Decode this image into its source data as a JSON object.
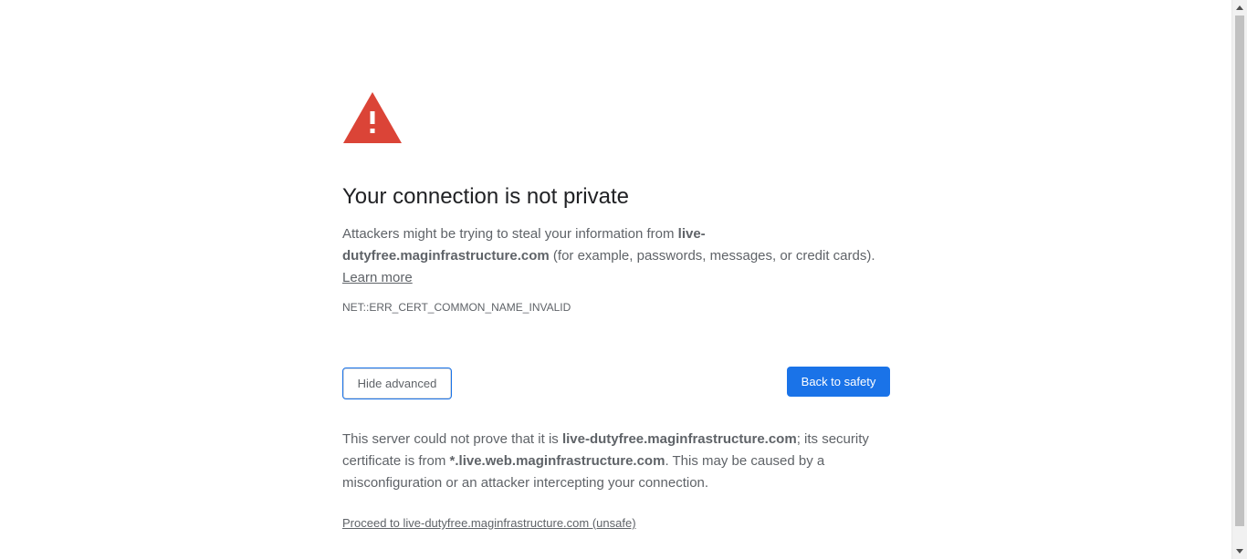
{
  "interstitial": {
    "heading": "Your connection is not private",
    "description": {
      "prefix": "Attackers might be trying to steal your information from ",
      "domain": "live-dutyfree.maginfrastructure.com",
      "suffix": " (for example, passwords, messages, or credit cards). ",
      "learn_more": "Learn more"
    },
    "error_code": "NET::ERR_CERT_COMMON_NAME_INVALID",
    "buttons": {
      "hide_advanced": "Hide advanced",
      "back_to_safety": "Back to safety"
    },
    "details": {
      "part1": "This server could not prove that it is ",
      "domain": "live-dutyfree.maginfrastructure.com",
      "part2": "; its security certificate is from ",
      "cert_domain": "*.live.web.maginfrastructure.com",
      "part3": ". This may be caused by a misconfiguration or an attacker intercepting your connection."
    },
    "proceed_link": "Proceed to live-dutyfree.maginfrastructure.com (unsafe)"
  },
  "colors": {
    "warning_red": "#db4437",
    "primary_blue": "#1a73e8",
    "text_grey": "#5f6368",
    "heading_dark": "#202124"
  },
  "icons": {
    "warning": "warning-triangle-icon",
    "scroll_up": "chevron-up-icon",
    "scroll_down": "chevron-down-icon"
  }
}
